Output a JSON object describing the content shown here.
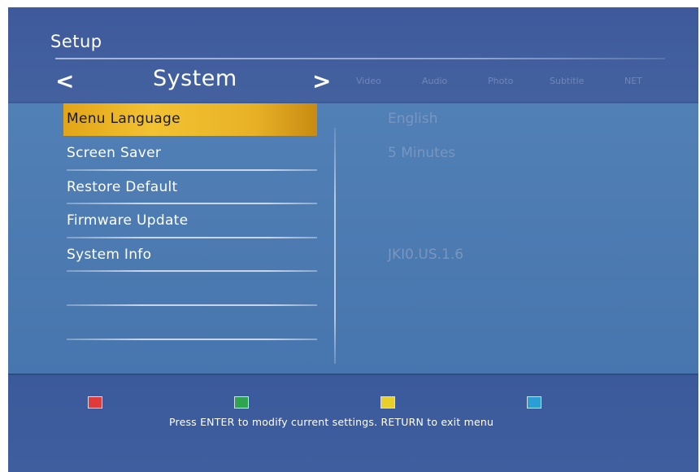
{
  "header": {
    "title": "Setup",
    "prev_arrow": "<",
    "next_arrow": ">",
    "current_tab": "System",
    "tabs": [
      "Video",
      "Audio",
      "Photo",
      "Subtitle",
      "NET"
    ]
  },
  "menu": {
    "items": [
      {
        "label": "Menu Language",
        "value": "English",
        "selected": true
      },
      {
        "label": "Screen Saver",
        "value": "5 Minutes",
        "selected": false
      },
      {
        "label": "Restore Default",
        "value": "",
        "selected": false
      },
      {
        "label": "Firmware Update",
        "value": "",
        "selected": false
      },
      {
        "label": "System Info",
        "value": "JKI0.US.1.6",
        "selected": false
      }
    ]
  },
  "footer": {
    "keys": [
      {
        "name": "red",
        "color": "#e03a3a"
      },
      {
        "name": "green",
        "color": "#2ea44f"
      },
      {
        "name": "yellow",
        "color": "#e8cf2a"
      },
      {
        "name": "blue",
        "color": "#2a9fd6"
      }
    ],
    "hint": "Press ENTER to modify current settings. RETURN to exit menu"
  },
  "colors": {
    "background": "#3f5e9e",
    "content_panel": "#4b79b1",
    "selection": "#f2c232",
    "inactive_tab": "#6f86b8",
    "value_text": "#7896c0"
  }
}
